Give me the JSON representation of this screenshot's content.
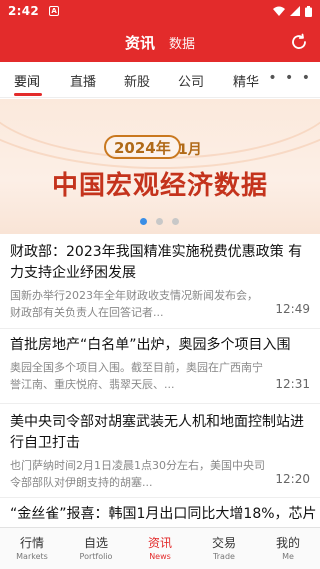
{
  "status_bar": {
    "time": "2:42",
    "notif_icon_letter": "A"
  },
  "header": {
    "title": "资讯",
    "subtitle": "数据"
  },
  "tabs": [
    {
      "label": "要闻",
      "active": true
    },
    {
      "label": "直播"
    },
    {
      "label": "新股"
    },
    {
      "label": "公司"
    },
    {
      "label": "精华"
    }
  ],
  "more_label": "• • •",
  "banner": {
    "year_pill": "2024年",
    "month": "1月",
    "headline": "中国宏观经济数据",
    "dots": 3,
    "active_dot": 0
  },
  "news": [
    {
      "title": "财政部：2023年我国精准实施税费优惠政策 有力支持企业纾困发展",
      "summary": "国新办举行2023年全年财政收支情况新闻发布会，财政部有关负责人在回答记者...",
      "time": "12:49"
    },
    {
      "title": "首批房地产“白名单”出炉，奥园多个项目入围",
      "summary": "奥园全国多个项目入围。截至目前，奥园在广西南宁誉江南、重庆悦府、翡翠天辰、...",
      "time": "12:31"
    },
    {
      "title": "美中央司令部对胡塞武装无人机和地面控制站进行自卫打击",
      "summary": "也门萨纳时间2月1日凌晨1点30分左右，美国中央司令部部队对伊朗支持的胡塞...",
      "time": "12:20"
    },
    {
      "title": "“金丝雀”报喜：韩国1月出口同比大增18%，芯片",
      "summary": "",
      "time": ""
    }
  ],
  "bottom_nav": [
    {
      "zh": "行情",
      "en": "Markets"
    },
    {
      "zh": "自选",
      "en": "Portfolio"
    },
    {
      "zh": "资讯",
      "en": "News",
      "active": true
    },
    {
      "zh": "交易",
      "en": "Trade"
    },
    {
      "zh": "我的",
      "en": "Me"
    }
  ],
  "colors": {
    "brand_red": "#e32b2b",
    "banner_gold": "#b06a18",
    "banner_red": "#c4331c",
    "dot_active": "#3a8ee6"
  }
}
